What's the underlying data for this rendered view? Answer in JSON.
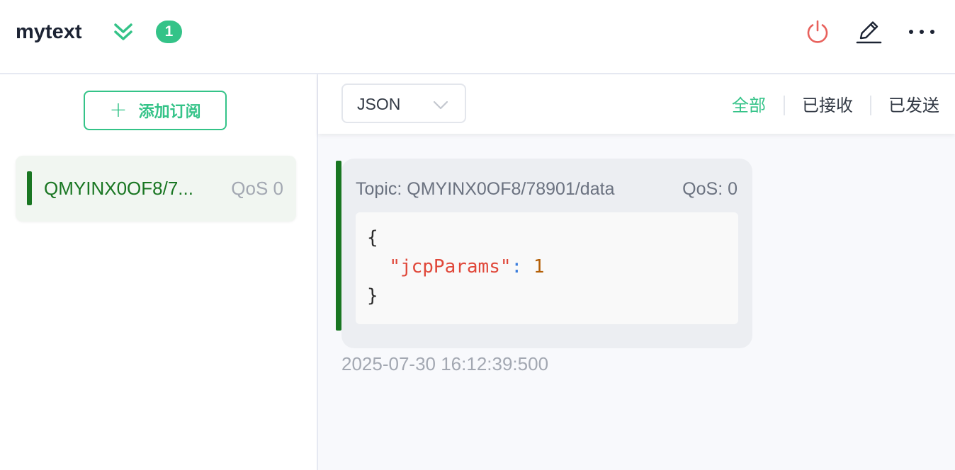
{
  "header": {
    "connection_name": "mytext",
    "unread_count": "1",
    "icons": [
      "chevrons-down-icon",
      "power-icon",
      "edit-icon",
      "more-icon"
    ],
    "colors": {
      "accent": "#34c388",
      "disconnect": "#e8615c"
    }
  },
  "sidebar": {
    "add_subscription_label": "添加订阅",
    "subscriptions": [
      {
        "topic": "QMYINX0OF8/7...",
        "qos": "QoS 0",
        "color": "#197622"
      }
    ]
  },
  "toolbar": {
    "format_value": "JSON",
    "tabs": [
      {
        "label": "全部",
        "active": true
      },
      {
        "label": "已接收",
        "active": false
      },
      {
        "label": "已发送",
        "active": false
      }
    ]
  },
  "messages": [
    {
      "topic": "Topic: QMYINX0OF8/78901/data",
      "qos": "QoS: 0",
      "payload": {
        "open": "{",
        "key": "\"jcpParams\"",
        "colon": ":",
        "value": "1",
        "close": "}"
      },
      "timestamp": "2025-07-30 16:12:39:500"
    }
  ]
}
